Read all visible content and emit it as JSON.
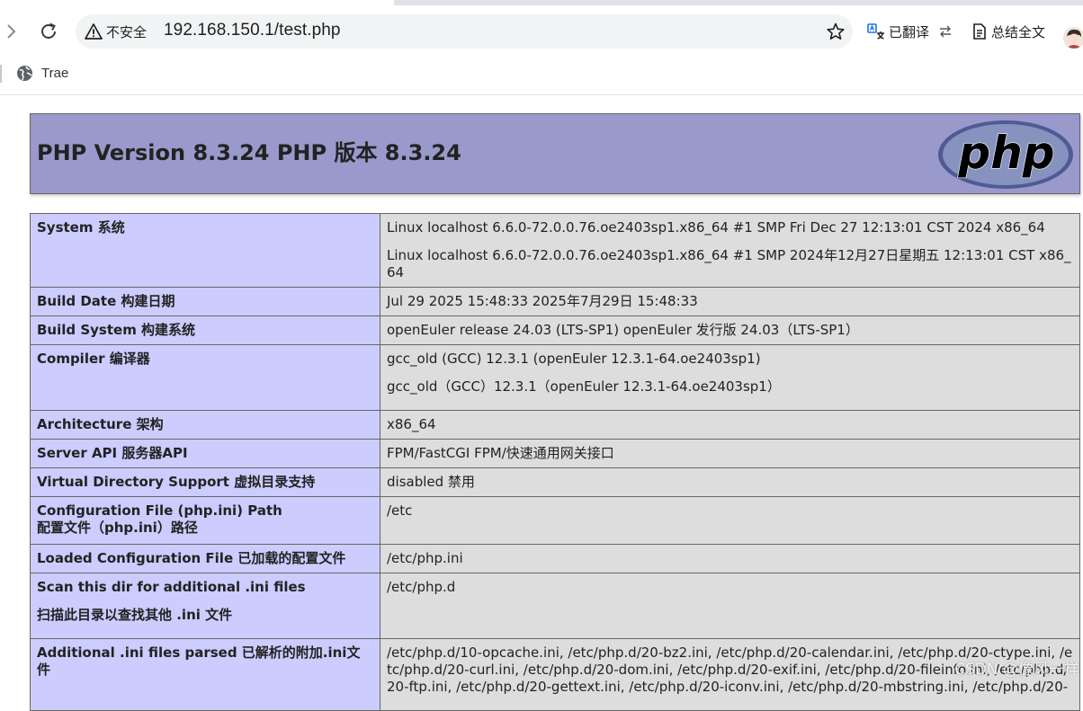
{
  "browser": {
    "address": {
      "security_label": "不安全",
      "url": "192.168.150.1/test.php"
    },
    "toolbar": {
      "translate_label": "已翻译",
      "summary_label": "总结全文"
    },
    "bookmarks": [
      {
        "label": "Trae",
        "icon": "globe-icon"
      }
    ]
  },
  "page": {
    "title": "PHP Version 8.3.24 PHP 版本 8.3.24",
    "logo_text": "php",
    "rows": [
      {
        "key": "System 系统",
        "value": "Linux localhost 6.6.0-72.0.0.76.oe2403sp1.x86_64 #1 SMP Fri Dec 27 12:13:01 CST 2024 x86_64",
        "value2": "Linux localhost 6.6.0-72.0.0.76.oe2403sp1.x86_64 #1 SMP 2024年12月27日星期五 12:13:01 CST x86_64"
      },
      {
        "key": "Build Date 构建日期",
        "value": "Jul 29 2025 15:48:33 2025年7月29日 15:48:33"
      },
      {
        "key": "Build System 构建系统",
        "value": "openEuler release 24.03 (LTS-SP1) openEuler 发行版 24.03（LTS-SP1）"
      },
      {
        "key": "Compiler 编译器",
        "value": "gcc_old (GCC) 12.3.1 (openEuler 12.3.1-64.oe2403sp1)",
        "value2": "gcc_old（GCC）12.3.1（openEuler 12.3.1-64.oe2403sp1）"
      },
      {
        "key": "Architecture 架构",
        "value": "x86_64"
      },
      {
        "key": "Server API 服务器API",
        "value": "FPM/FastCGI FPM/快速通用网关接口"
      },
      {
        "key": "Virtual Directory Support 虚拟目录支持",
        "value": "disabled 禁用"
      },
      {
        "key": "Configuration File (php.ini) Path",
        "key2": "配置文件（php.ini）路径",
        "value": "/etc"
      },
      {
        "key": "Loaded Configuration File 已加载的配置文件",
        "value": "/etc/php.ini"
      },
      {
        "key": "Scan this dir for additional .ini files",
        "key2": "扫描此目录以查找其他 .ini 文件",
        "value": "/etc/php.d"
      },
      {
        "key": "Additional .ini files parsed 已解析的附加.ini文件",
        "value": "/etc/php.d/10-opcache.ini, /etc/php.d/20-bz2.ini, /etc/php.d/20-calendar.ini, /etc/php.d/20-ctype.ini, /etc/php.d/20-curl.ini, /etc/php.d/20-dom.ini, /etc/php.d/20-exif.ini, /etc/php.d/20-fileinfo.ini, /etc/php.d/20-ftp.ini, /etc/php.d/20-gettext.ini, /etc/php.d/20-iconv.ini, /etc/php.d/20-mbstring.ini, /etc/php.d/20-"
      }
    ]
  },
  "watermark": "CSDN @像风一样"
}
